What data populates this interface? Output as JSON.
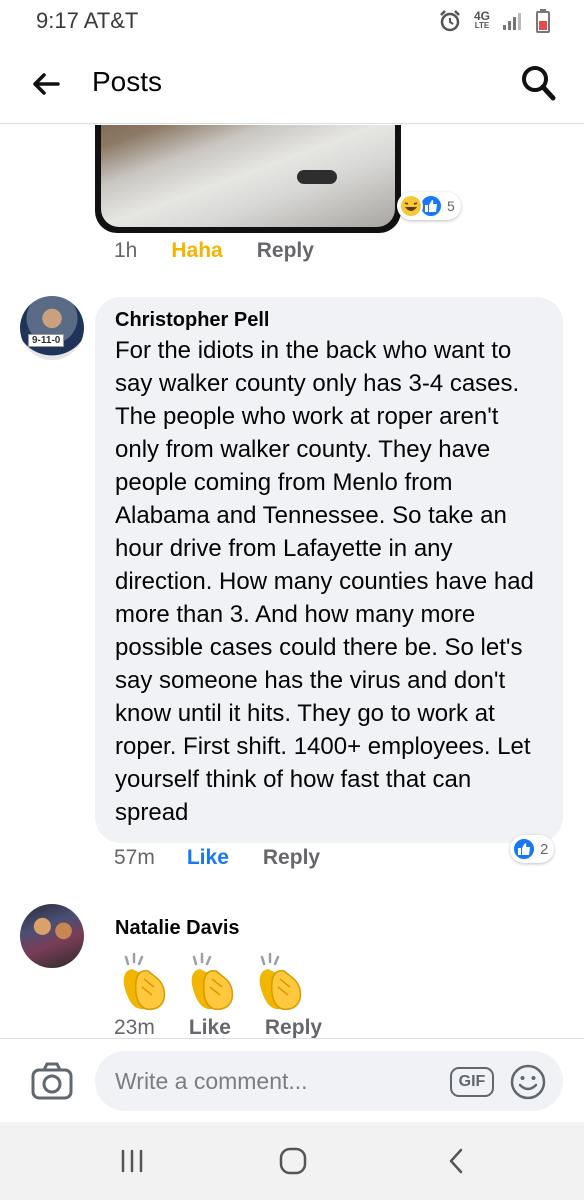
{
  "status_bar": {
    "time_carrier": "9:17 AT&T",
    "network": "4G",
    "network_sub": "LTE"
  },
  "app_bar": {
    "title": "Posts",
    "back_icon": "arrow-left-icon",
    "search_icon": "search-icon"
  },
  "prev_comment": {
    "reaction_count": "5",
    "time": "1h",
    "reaction_label": "Haha",
    "reply_label": "Reply"
  },
  "comments": [
    {
      "author": "Christopher Pell",
      "avatar_badge": "9-11-0",
      "text": "For the idiots in the back who want to say walker county only has 3-4 cases. The people who work at roper aren't only from walker county. They have people coming from Menlo from Alabama and Tennessee. So take an hour drive from Lafayette in any direction. How many counties have had more than 3. And how many more possible cases could there be. So let's say someone has the virus and don't know until it hits. They go to work at roper. First shift. 1400+ employees. Let yourself think of how fast that can spread",
      "time": "57m",
      "like_label": "Like",
      "reply_label": "Reply",
      "like_count": "2"
    },
    {
      "author": "Natalie Davis",
      "content": "three clapping-hands emoji",
      "time": "23m",
      "like_label": "Like",
      "reply_label": "Reply"
    }
  ],
  "composer": {
    "placeholder": "Write a comment...",
    "gif_label": "GIF",
    "camera_icon": "camera-icon",
    "emoji_icon": "smiley-icon"
  },
  "nav_bar": {
    "recents_icon": "recent-apps-icon",
    "home_icon": "home-icon",
    "back_icon": "back-chevron-icon"
  },
  "colors": {
    "link_blue": "#1877f2",
    "haha_yellow": "#f5b400",
    "bubble_gray": "#f0f2f5",
    "meta_gray": "#65676b"
  }
}
